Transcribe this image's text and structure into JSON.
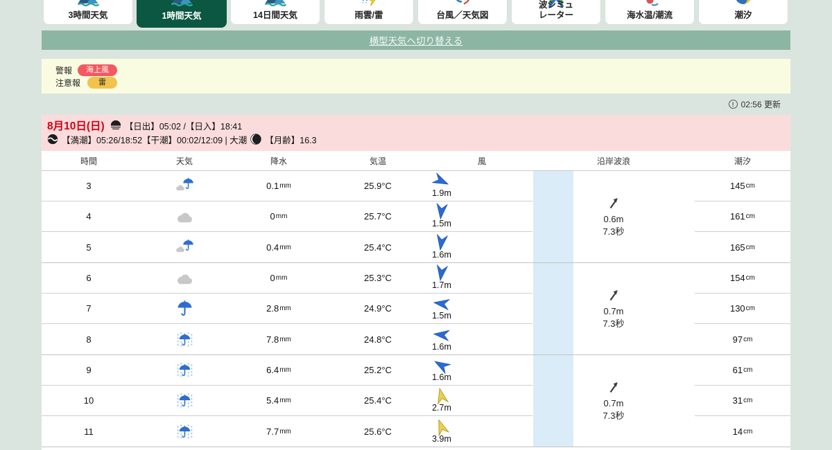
{
  "tabs": [
    {
      "key": "3h-weather",
      "label": "3時間天気",
      "icon": "weather",
      "selected": false
    },
    {
      "key": "1h-weather",
      "label": "1時間天気",
      "icon": "weather",
      "selected": true
    },
    {
      "key": "14d-weather",
      "label": "14日間天気",
      "icon": "weather",
      "selected": false
    },
    {
      "key": "rain-cloud-radar",
      "label": "雨雲/雷",
      "icon": "rain-thunder",
      "selected": false
    },
    {
      "key": "typhoon-chart",
      "label": "台風／天気図",
      "icon": "typhoon",
      "selected": false
    },
    {
      "key": "wave-simulator",
      "label": "波シミュ",
      "label2": "レーター",
      "icon": "wave-sim",
      "selected": false
    },
    {
      "key": "sea-temp-current",
      "label": "海水温/潮流",
      "icon": "sea-temp",
      "selected": false
    },
    {
      "key": "tide",
      "label": "潮汐",
      "icon": "tide",
      "selected": false
    }
  ],
  "switch_link": "横型天気へ切り替える",
  "alerts": {
    "warning_label": "警報",
    "warning_badge": "海上風",
    "advisory_label": "注意報",
    "advisory_badge": "雷"
  },
  "updated": "02:56 更新",
  "date_header": {
    "date": "8月10日(日)",
    "sun": "【日出】05:02 /【日入】18:41",
    "tide_info": "【満潮】05:26/18:52【干潮】00:02/12:09 | 大潮",
    "moon": "【月齢】16.3"
  },
  "table": {
    "headers": [
      "時間",
      "天気",
      "降水",
      "気温",
      "風",
      "沿岸波浪",
      "潮汐"
    ],
    "units": {
      "precip": "mm",
      "tide": "cm"
    },
    "rows": [
      {
        "hour": "3",
        "weather": "rain-cloud",
        "precip": "0.1",
        "temp": "25.9°C",
        "wind": {
          "speed": "1.9m",
          "dir": 115,
          "level": "blue"
        },
        "tide": "145"
      },
      {
        "hour": "4",
        "weather": "cloud",
        "precip": "0",
        "temp": "25.7°C",
        "wind": {
          "speed": "1.5m",
          "dir": 186,
          "level": "blue"
        },
        "tide": "161"
      },
      {
        "hour": "5",
        "weather": "rain-cloud",
        "precip": "0.4",
        "temp": "25.4°C",
        "wind": {
          "speed": "1.6m",
          "dir": 188,
          "level": "blue"
        },
        "tide": "165"
      },
      {
        "hour": "6",
        "weather": "cloud",
        "precip": "0",
        "temp": "25.3°C",
        "wind": {
          "speed": "1.7m",
          "dir": 188,
          "level": "blue"
        },
        "tide": "154"
      },
      {
        "hour": "7",
        "weather": "rain",
        "precip": "2.8",
        "temp": "24.9°C",
        "wind": {
          "speed": "1.5m",
          "dir": 278,
          "level": "blue"
        },
        "tide": "130"
      },
      {
        "hour": "8",
        "weather": "heavy-rain",
        "precip": "7.8",
        "temp": "24.8°C",
        "wind": {
          "speed": "1.6m",
          "dir": 276,
          "level": "blue"
        },
        "tide": "97"
      },
      {
        "hour": "9",
        "weather": "heavy-rain",
        "precip": "6.4",
        "temp": "25.2°C",
        "wind": {
          "speed": "1.6m",
          "dir": 300,
          "level": "blue"
        },
        "tide": "61"
      },
      {
        "hour": "10",
        "weather": "heavy-rain",
        "precip": "5.4",
        "temp": "25.4°C",
        "wind": {
          "speed": "2.7m",
          "dir": 347,
          "level": "yellow"
        },
        "tide": "31"
      },
      {
        "hour": "11",
        "weather": "heavy-rain",
        "precip": "7.7",
        "temp": "25.6°C",
        "wind": {
          "speed": "3.9m",
          "dir": 340,
          "level": "yellow"
        },
        "tide": "14"
      }
    ],
    "wave_groups": [
      {
        "height": "0.6m",
        "period": "7.3秒"
      },
      {
        "height": "0.7m",
        "period": "7.3秒"
      },
      {
        "height": "0.7m",
        "period": "7.3秒"
      }
    ]
  },
  "colors": {
    "accent_green": "#0b5742",
    "bar_green": "#8db5a3",
    "alert_bg": "#fafce1",
    "warning_badge": "#f4595f",
    "advisory_badge": "#f1c34d",
    "date_bg": "#fbdcdc",
    "date_red": "#d40012",
    "daylight_band": "#d9ecf8",
    "wind_blue": "#2b6cd2",
    "wind_yellow": "#ecd04c",
    "page_bg": "#dbe5e0"
  }
}
